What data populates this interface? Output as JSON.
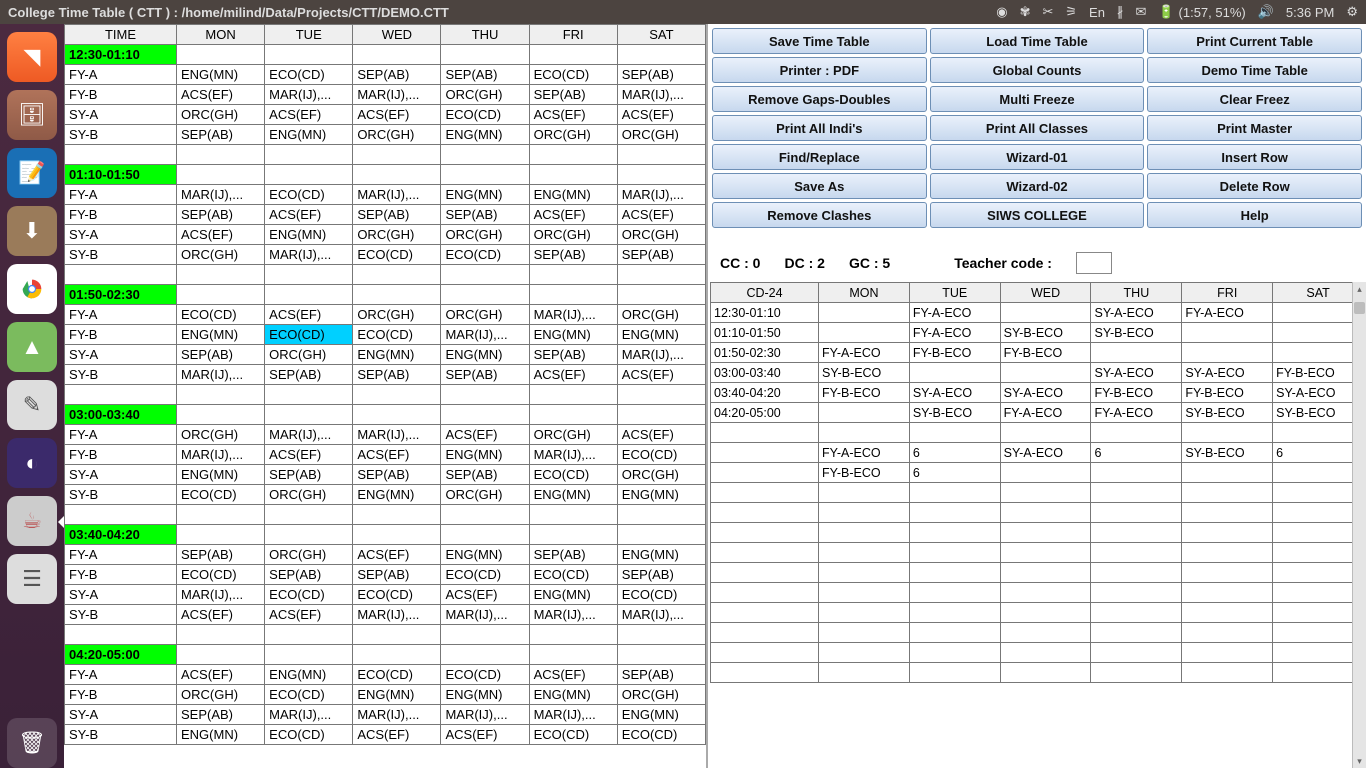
{
  "window": {
    "title": "College Time Table ( CTT ) : /home/milind/Data/Projects/CTT/DEMO.CTT"
  },
  "statusbar": {
    "battery": "(1:57, 51%)",
    "time": "5:36 PM",
    "lang": "En"
  },
  "timetable": {
    "headers": [
      "TIME",
      "MON",
      "TUE",
      "WED",
      "THU",
      "FRI",
      "SAT"
    ],
    "rows": [
      {
        "slot": true,
        "cells": [
          "12:30-01:10",
          "",
          "",
          "",
          "",
          "",
          ""
        ]
      },
      {
        "cells": [
          "FY-A",
          "ENG(MN)",
          "ECO(CD)",
          "SEP(AB)",
          "SEP(AB)",
          "ECO(CD)",
          "SEP(AB)"
        ]
      },
      {
        "cells": [
          "FY-B",
          "ACS(EF)",
          "MAR(IJ),...",
          "MAR(IJ),...",
          "ORC(GH)",
          "SEP(AB)",
          "MAR(IJ),..."
        ]
      },
      {
        "cells": [
          "SY-A",
          "ORC(GH)",
          "ACS(EF)",
          "ACS(EF)",
          "ECO(CD)",
          "ACS(EF)",
          "ACS(EF)"
        ]
      },
      {
        "cells": [
          "SY-B",
          "SEP(AB)",
          "ENG(MN)",
          "ORC(GH)",
          "ENG(MN)",
          "ORC(GH)",
          "ORC(GH)"
        ]
      },
      {
        "cells": [
          "",
          "",
          "",
          "",
          "",
          "",
          ""
        ]
      },
      {
        "slot": true,
        "cells": [
          "01:10-01:50",
          "",
          "",
          "",
          "",
          "",
          ""
        ]
      },
      {
        "cells": [
          "FY-A",
          "MAR(IJ),...",
          "ECO(CD)",
          "MAR(IJ),...",
          "ENG(MN)",
          "ENG(MN)",
          "MAR(IJ),..."
        ]
      },
      {
        "cells": [
          "FY-B",
          "SEP(AB)",
          "ACS(EF)",
          "SEP(AB)",
          "SEP(AB)",
          "ACS(EF)",
          "ACS(EF)"
        ]
      },
      {
        "cells": [
          "SY-A",
          "ACS(EF)",
          "ENG(MN)",
          "ORC(GH)",
          "ORC(GH)",
          "ORC(GH)",
          "ORC(GH)"
        ]
      },
      {
        "cells": [
          "SY-B",
          "ORC(GH)",
          "MAR(IJ),...",
          "ECO(CD)",
          "ECO(CD)",
          "SEP(AB)",
          "SEP(AB)"
        ]
      },
      {
        "cells": [
          "",
          "",
          "",
          "",
          "",
          "",
          ""
        ]
      },
      {
        "slot": true,
        "cells": [
          "01:50-02:30",
          "",
          "",
          "",
          "",
          "",
          ""
        ]
      },
      {
        "cells": [
          "FY-A",
          "ECO(CD)",
          "ACS(EF)",
          "ORC(GH)",
          "ORC(GH)",
          "MAR(IJ),...",
          "ORC(GH)"
        ]
      },
      {
        "cells": [
          "FY-B",
          "ENG(MN)",
          "ECO(CD)",
          "ECO(CD)",
          "MAR(IJ),...",
          "ENG(MN)",
          "ENG(MN)"
        ],
        "hi": 2
      },
      {
        "cells": [
          "SY-A",
          "SEP(AB)",
          "ORC(GH)",
          "ENG(MN)",
          "ENG(MN)",
          "SEP(AB)",
          "MAR(IJ),..."
        ]
      },
      {
        "cells": [
          "SY-B",
          "MAR(IJ),...",
          "SEP(AB)",
          "SEP(AB)",
          "SEP(AB)",
          "ACS(EF)",
          "ACS(EF)"
        ]
      },
      {
        "cells": [
          "",
          "",
          "",
          "",
          "",
          "",
          ""
        ]
      },
      {
        "slot": true,
        "cells": [
          "03:00-03:40",
          "",
          "",
          "",
          "",
          "",
          ""
        ]
      },
      {
        "cells": [
          "FY-A",
          "ORC(GH)",
          "MAR(IJ),...",
          "MAR(IJ),...",
          "ACS(EF)",
          "ORC(GH)",
          "ACS(EF)"
        ]
      },
      {
        "cells": [
          "FY-B",
          "MAR(IJ),...",
          "ACS(EF)",
          "ACS(EF)",
          "ENG(MN)",
          "MAR(IJ),...",
          "ECO(CD)"
        ]
      },
      {
        "cells": [
          "SY-A",
          "ENG(MN)",
          "SEP(AB)",
          "SEP(AB)",
          "SEP(AB)",
          "ECO(CD)",
          "ORC(GH)"
        ]
      },
      {
        "cells": [
          "SY-B",
          "ECO(CD)",
          "ORC(GH)",
          "ENG(MN)",
          "ORC(GH)",
          "ENG(MN)",
          "ENG(MN)"
        ]
      },
      {
        "cells": [
          "",
          "",
          "",
          "",
          "",
          "",
          ""
        ]
      },
      {
        "slot": true,
        "cells": [
          "03:40-04:20",
          "",
          "",
          "",
          "",
          "",
          ""
        ]
      },
      {
        "cells": [
          "FY-A",
          "SEP(AB)",
          "ORC(GH)",
          "ACS(EF)",
          "ENG(MN)",
          "SEP(AB)",
          "ENG(MN)"
        ]
      },
      {
        "cells": [
          "FY-B",
          "ECO(CD)",
          "SEP(AB)",
          "SEP(AB)",
          "ECO(CD)",
          "ECO(CD)",
          "SEP(AB)"
        ]
      },
      {
        "cells": [
          "SY-A",
          "MAR(IJ),...",
          "ECO(CD)",
          "ECO(CD)",
          "ACS(EF)",
          "ENG(MN)",
          "ECO(CD)"
        ]
      },
      {
        "cells": [
          "SY-B",
          "ACS(EF)",
          "ACS(EF)",
          "MAR(IJ),...",
          "MAR(IJ),...",
          "MAR(IJ),...",
          "MAR(IJ),..."
        ]
      },
      {
        "cells": [
          "",
          "",
          "",
          "",
          "",
          "",
          ""
        ]
      },
      {
        "slot": true,
        "cells": [
          "04:20-05:00",
          "",
          "",
          "",
          "",
          "",
          ""
        ]
      },
      {
        "cells": [
          "FY-A",
          "ACS(EF)",
          "ENG(MN)",
          "ECO(CD)",
          "ECO(CD)",
          "ACS(EF)",
          "SEP(AB)"
        ]
      },
      {
        "cells": [
          "FY-B",
          "ORC(GH)",
          "ECO(CD)",
          "ENG(MN)",
          "ENG(MN)",
          "ENG(MN)",
          "ORC(GH)"
        ]
      },
      {
        "cells": [
          "SY-A",
          "SEP(AB)",
          "MAR(IJ),...",
          "MAR(IJ),...",
          "MAR(IJ),...",
          "MAR(IJ),...",
          "ENG(MN)"
        ]
      },
      {
        "cells": [
          "SY-B",
          "ENG(MN)",
          "ECO(CD)",
          "ACS(EF)",
          "ACS(EF)",
          "ECO(CD)",
          "ECO(CD)"
        ]
      }
    ]
  },
  "buttons": [
    "Save Time Table",
    "Load Time Table",
    "Print Current Table",
    "Printer : PDF",
    "Global Counts",
    "Demo Time Table",
    "Remove Gaps-Doubles",
    "Multi Freeze",
    "Clear Freez",
    "Print All Indi's",
    "Print All Classes",
    "Print Master",
    "Find/Replace",
    "Wizard-01",
    "Insert Row",
    "Save As",
    "Wizard-02",
    "Delete Row",
    "Remove Clashes",
    "SIWS COLLEGE",
    "Help"
  ],
  "info": {
    "cc_label": "CC :",
    "cc": "0",
    "dc_label": "DC :",
    "dc": "2",
    "gc_label": "GC :",
    "gc": "5",
    "tcode_label": "Teacher code :"
  },
  "rtable": {
    "headers": [
      "CD-24",
      "MON",
      "TUE",
      "WED",
      "THU",
      "FRI",
      "SAT"
    ],
    "rows": [
      [
        "12:30-01:10",
        "",
        "FY-A-ECO",
        "",
        "SY-A-ECO",
        "FY-A-ECO",
        ""
      ],
      [
        "01:10-01:50",
        "",
        "FY-A-ECO",
        "SY-B-ECO",
        "SY-B-ECO",
        "",
        ""
      ],
      [
        "01:50-02:30",
        "FY-A-ECO",
        "FY-B-ECO",
        "FY-B-ECO",
        "",
        "",
        ""
      ],
      [
        "03:00-03:40",
        "SY-B-ECO",
        "",
        "",
        "SY-A-ECO",
        "SY-A-ECO",
        "FY-B-ECO"
      ],
      [
        "03:40-04:20",
        "FY-B-ECO",
        "SY-A-ECO",
        "SY-A-ECO",
        "FY-B-ECO",
        "FY-B-ECO",
        "SY-A-ECO"
      ],
      [
        "04:20-05:00",
        "",
        "SY-B-ECO",
        "FY-A-ECO",
        "FY-A-ECO",
        "SY-B-ECO",
        "SY-B-ECO"
      ],
      [
        "",
        "",
        "",
        "",
        "",
        "",
        ""
      ],
      [
        "",
        "FY-A-ECO",
        "6",
        "SY-A-ECO",
        "6",
        "SY-B-ECO",
        "6"
      ],
      [
        "",
        "FY-B-ECO",
        "6",
        "",
        "",
        "",
        ""
      ],
      [
        "",
        "",
        "",
        "",
        "",
        "",
        ""
      ],
      [
        "",
        "",
        "",
        "",
        "",
        "",
        ""
      ],
      [
        "",
        "",
        "",
        "",
        "",
        "",
        ""
      ],
      [
        "",
        "",
        "",
        "",
        "",
        "",
        ""
      ],
      [
        "",
        "",
        "",
        "",
        "",
        "",
        ""
      ],
      [
        "",
        "",
        "",
        "",
        "",
        "",
        ""
      ],
      [
        "",
        "",
        "",
        "",
        "",
        "",
        ""
      ],
      [
        "",
        "",
        "",
        "",
        "",
        "",
        ""
      ],
      [
        "",
        "",
        "",
        "",
        "",
        "",
        ""
      ],
      [
        "",
        "",
        "",
        "",
        "",
        "",
        ""
      ]
    ]
  }
}
